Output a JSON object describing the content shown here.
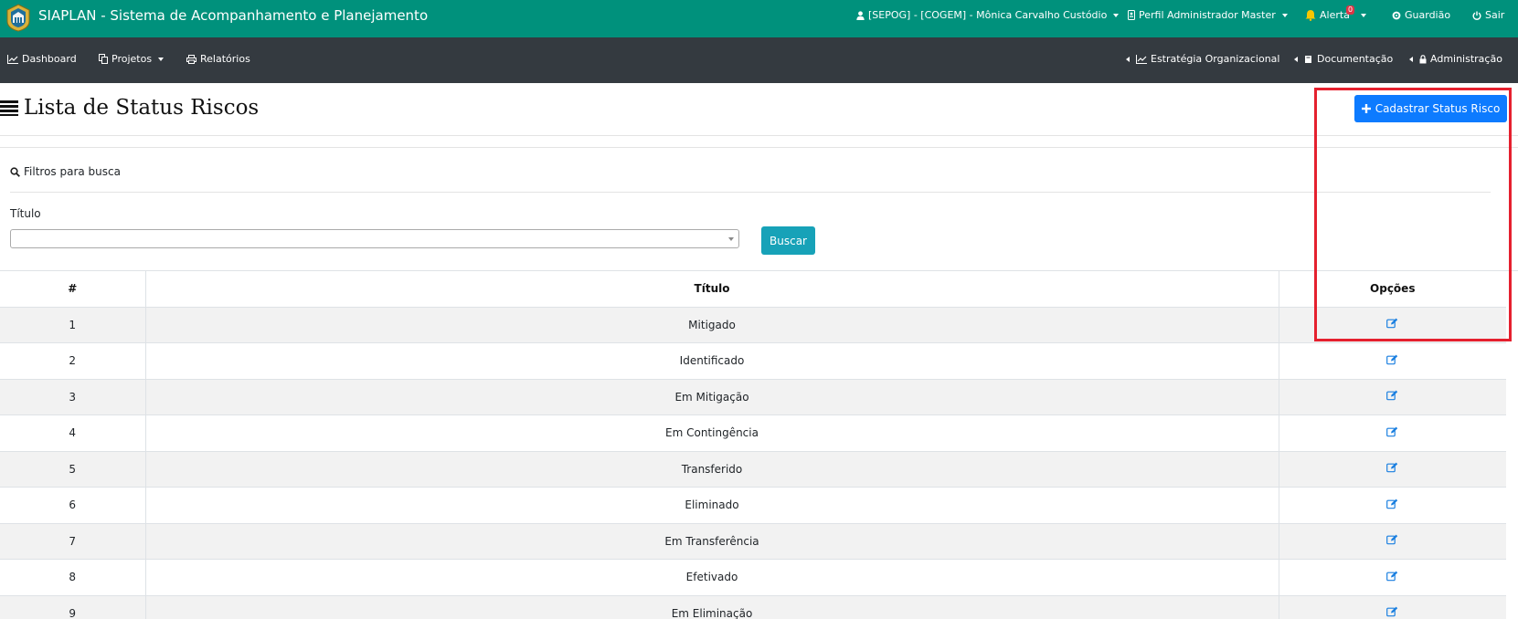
{
  "header": {
    "app_title": "SIAPLAN - Sistema de Acompanhamento e Planejamento",
    "user_label": "[SEPOG] - [COGEM] - Mônica Carvalho Custódio",
    "profile_label": "Perfil Administrador Master",
    "alert_label": "Alerta",
    "alert_count": "0",
    "guardiao_label": "Guardião",
    "logout_label": "Sair"
  },
  "nav": {
    "dashboard": "Dashboard",
    "projetos": "Projetos",
    "relatorios": "Relatórios",
    "estrategia": "Estratégia Organizacional",
    "documentacao": "Documentação",
    "administracao": "Administração"
  },
  "page": {
    "title": "Lista de Status Riscos",
    "add_button": "Cadastrar Status Risco"
  },
  "filters": {
    "title": "Filtros para busca",
    "titulo_label": "Título",
    "titulo_value": "",
    "search_button": "Buscar"
  },
  "table": {
    "headers": [
      "#",
      "Título",
      "Opções"
    ],
    "rows": [
      {
        "id": "1",
        "titulo": "Mitigado"
      },
      {
        "id": "2",
        "titulo": "Identificado"
      },
      {
        "id": "3",
        "titulo": "Em Mitigação"
      },
      {
        "id": "4",
        "titulo": "Em Contingência"
      },
      {
        "id": "5",
        "titulo": "Transferido"
      },
      {
        "id": "6",
        "titulo": "Eliminado"
      },
      {
        "id": "7",
        "titulo": "Em Transferência"
      },
      {
        "id": "8",
        "titulo": "Efetivado"
      },
      {
        "id": "9",
        "titulo": "Em Eliminação"
      }
    ]
  },
  "icons": {
    "user": "user-icon",
    "profile": "id-card-icon",
    "alert": "bell-icon",
    "guardiao": "gear-icon",
    "logout": "power-icon",
    "dashboard": "line-chart-icon",
    "projetos": "copy-icon",
    "relatorios": "print-icon",
    "title": "list-icon",
    "add": "plus-icon",
    "search": "search-icon",
    "edit": "edit-icon"
  },
  "colors": {
    "topbar": "#00917c",
    "navbar": "#343a40",
    "primary": "#0d7bff",
    "info": "#17a2b8",
    "highlight": "#e5202e"
  }
}
